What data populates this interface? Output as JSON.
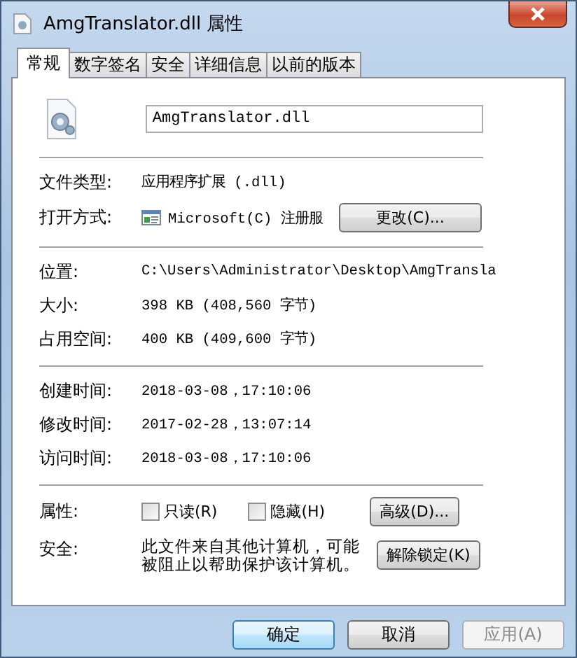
{
  "window": {
    "title": "AmgTranslator.dll 属性"
  },
  "tabs": [
    {
      "label": "常规",
      "selected": true
    },
    {
      "label": "数字签名",
      "selected": false
    },
    {
      "label": "安全",
      "selected": false
    },
    {
      "label": "详细信息",
      "selected": false
    },
    {
      "label": "以前的版本",
      "selected": false
    }
  ],
  "file_name": {
    "value": "AmgTranslator.dll"
  },
  "sections": [
    {
      "rows": [
        {
          "label": "文件类型:",
          "value": "应用程序扩展 (.dll)"
        },
        {
          "label": "打开方式:",
          "value": "Microsoft(C) 注册服",
          "button": "更改(C)...",
          "kind": "app"
        }
      ]
    },
    {
      "rows": [
        {
          "label": "位置:",
          "value": "C:\\Users\\Administrator\\Desktop\\AmgTransla"
        },
        {
          "label": "大小:",
          "value": "398 KB (408,560 字节)"
        },
        {
          "label": "占用空间:",
          "value": "400 KB (409,600 字节)"
        }
      ]
    },
    {
      "rows": [
        {
          "label": "创建时间:",
          "value": "2018-03-08，17:10:06"
        },
        {
          "label": "修改时间:",
          "value": "2017-02-28，13:07:14"
        },
        {
          "label": "访问时间:",
          "value": "2018-03-08，17:10:06"
        }
      ]
    }
  ],
  "attributes": {
    "label": "属性:",
    "checkboxes": [
      {
        "label": "只读(R)",
        "checked": false
      },
      {
        "label": "隐藏(H)",
        "checked": false
      }
    ],
    "button": "高级(D)..."
  },
  "security": {
    "label": "安全:",
    "text": "此文件来自其他计算机，可能被阻止以帮助保护该计算机。",
    "button": "解除锁定(K)"
  },
  "buttons": [
    {
      "label": "确定",
      "default": true,
      "disabled": false
    },
    {
      "label": "取消",
      "default": false,
      "disabled": false
    },
    {
      "label": "应用(A)",
      "default": false,
      "disabled": true
    }
  ]
}
